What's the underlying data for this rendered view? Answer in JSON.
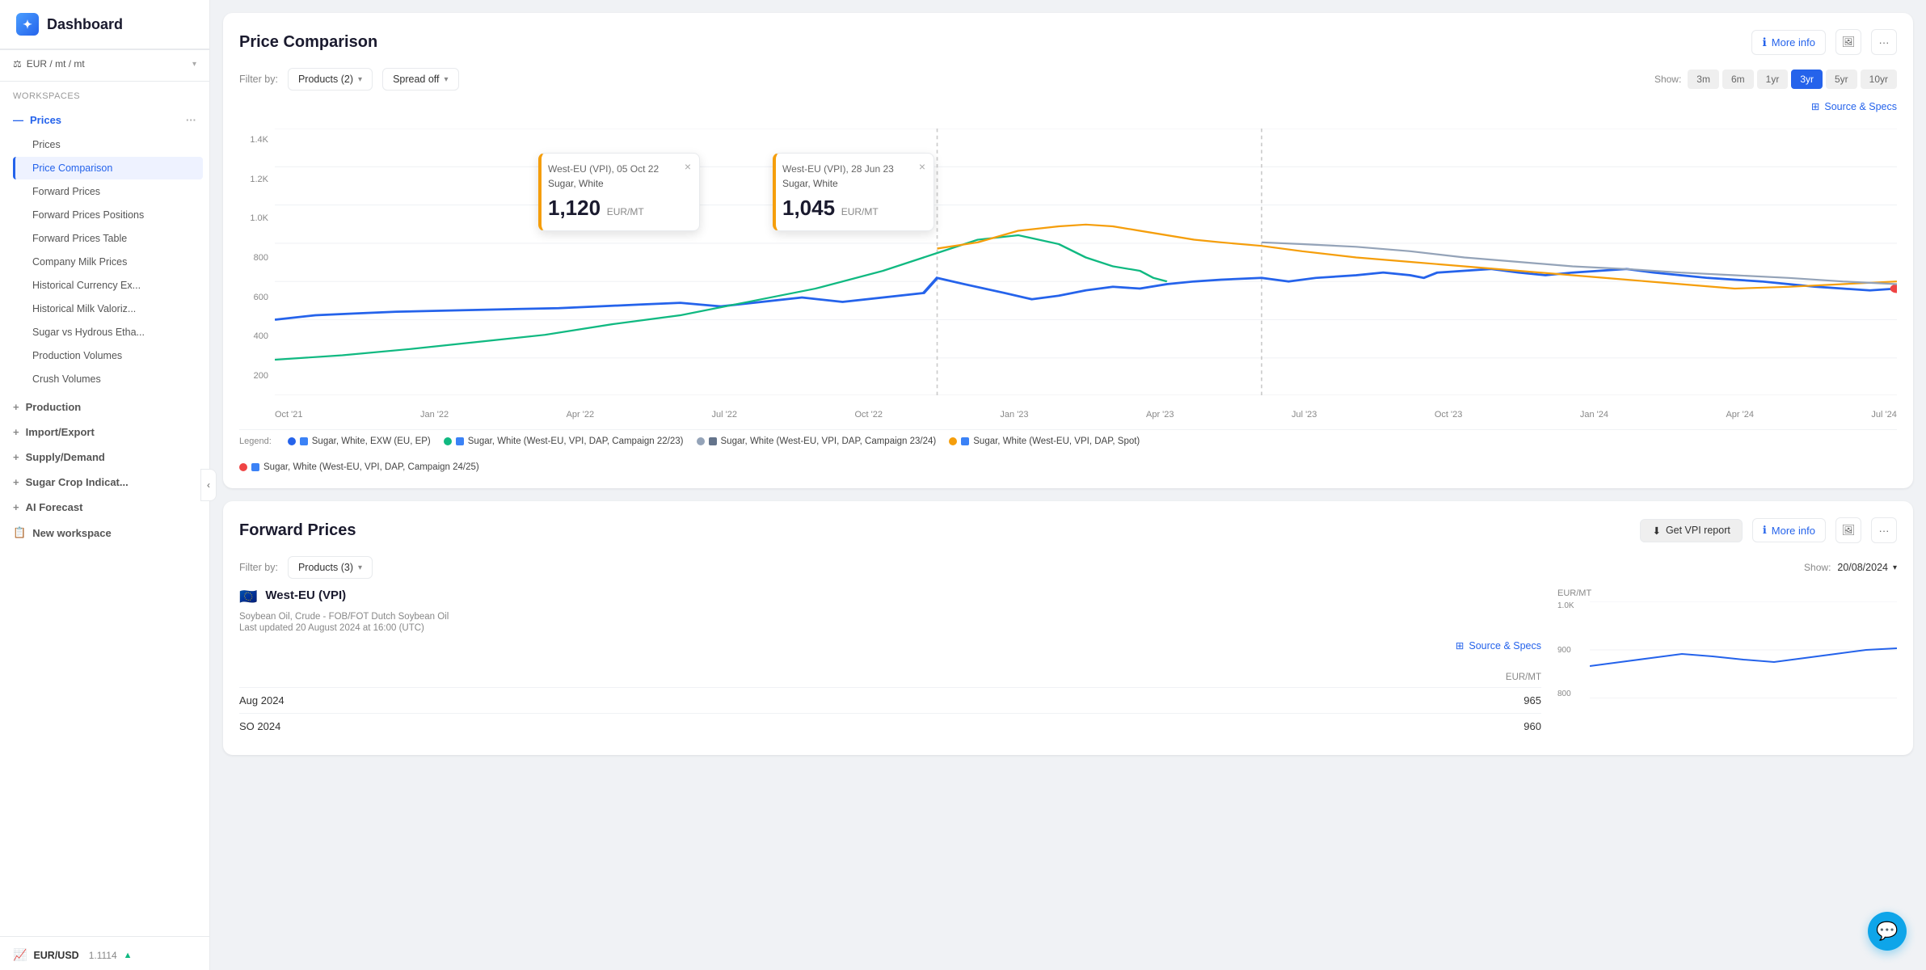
{
  "sidebar": {
    "title": "Dashboard",
    "currency_label": "EUR / mt / mt",
    "workspaces_label": "Workspaces",
    "groups": [
      {
        "id": "prices",
        "label": "Prices",
        "expanded": true,
        "items": [
          {
            "id": "prices-main",
            "label": "Prices",
            "active": false
          },
          {
            "id": "price-comparison",
            "label": "Price Comparison",
            "active": true
          },
          {
            "id": "forward-prices",
            "label": "Forward Prices",
            "active": false
          },
          {
            "id": "forward-prices-positions",
            "label": "Forward Prices Positions",
            "active": false
          },
          {
            "id": "forward-prices-table",
            "label": "Forward Prices Table",
            "active": false
          },
          {
            "id": "company-milk-prices",
            "label": "Company Milk Prices",
            "active": false
          },
          {
            "id": "historical-currency",
            "label": "Historical Currency Ex...",
            "active": false
          },
          {
            "id": "historical-milk",
            "label": "Historical Milk Valoriz...",
            "active": false
          },
          {
            "id": "sugar-vs-hydrous",
            "label": "Sugar vs Hydrous Etha...",
            "active": false
          },
          {
            "id": "production-volumes",
            "label": "Production Volumes",
            "active": false
          },
          {
            "id": "crush-volumes",
            "label": "Crush Volumes",
            "active": false
          }
        ]
      },
      {
        "id": "production",
        "label": "Production",
        "expanded": false
      },
      {
        "id": "import-export",
        "label": "Import/Export",
        "expanded": false
      },
      {
        "id": "supply-demand",
        "label": "Supply/Demand",
        "expanded": false
      },
      {
        "id": "sugar-crop",
        "label": "Sugar Crop Indicat...",
        "expanded": false
      },
      {
        "id": "ai-forecast",
        "label": "AI Forecast",
        "expanded": false
      },
      {
        "id": "new-workspace",
        "label": "New workspace",
        "expanded": false
      }
    ],
    "footer": {
      "currency_pair": "EUR/USD",
      "rate": "1.1114",
      "trend": "up"
    }
  },
  "price_comparison": {
    "title": "Price Comparison",
    "more_info": "More info",
    "filter_label": "Filter by:",
    "filter_value": "Products (2)",
    "spread_label": "Spread off",
    "show_label": "Show:",
    "show_options": [
      "3m",
      "6m",
      "1yr",
      "3yr",
      "5yr",
      "10yr"
    ],
    "active_show": "3yr",
    "source_specs": "Source & Specs",
    "y_labels": [
      "1.4K",
      "1.2K",
      "1.0K",
      "800",
      "600",
      "400",
      "200"
    ],
    "x_labels": [
      "Oct '21",
      "Jan '22",
      "Apr '22",
      "Jul '22",
      "Oct '22",
      "Jan '23",
      "Apr '23",
      "Jul '23",
      "Oct '23",
      "Jan '24",
      "Apr '24",
      "Jul '24"
    ],
    "tooltip1": {
      "location": "West-EU (VPI), 05 Oct 22",
      "product": "Sugar, White",
      "value": "1,120",
      "unit": "EUR/MT"
    },
    "tooltip2": {
      "location": "West-EU (VPI), 28 Jun 23",
      "product": "Sugar, White",
      "value": "1,045",
      "unit": "EUR/MT"
    },
    "legend": [
      {
        "id": "legend-1",
        "color": "#2563eb",
        "shape": "dot",
        "label": "Sugar, White, EXW (EU, EP)"
      },
      {
        "id": "legend-2",
        "color": "#10b981",
        "shape": "dot",
        "flag_color": "#2563eb",
        "label": "Sugar, White (West-EU, VPI, DAP, Campaign 22/23)"
      },
      {
        "id": "legend-3",
        "color": "#94a3b8",
        "shape": "dot",
        "flag_color": "#64748b",
        "label": "Sugar, White (West-EU, VPI, DAP, Campaign 23/24)"
      },
      {
        "id": "legend-4",
        "color": "#f59e0b",
        "shape": "dot",
        "flag_color": "#2563eb",
        "label": "Sugar, White (West-EU, VPI, DAP, Spot)"
      },
      {
        "id": "legend-5",
        "color": "#ef4444",
        "shape": "dot",
        "flag_color": "#2563eb",
        "label": "Sugar, White (West-EU, VPI, DAP, Campaign 24/25)"
      }
    ]
  },
  "forward_prices": {
    "title": "Forward Prices",
    "get_vpi_report": "Get VPI report",
    "more_info": "More info",
    "filter_label": "Filter by:",
    "filter_value": "Products (3)",
    "show_label": "Show:",
    "show_date": "20/08/2024",
    "source_specs": "Source & Specs",
    "product": {
      "region": "West-EU (VPI)",
      "name": "Soybean Oil, Crude - FOB/FOT Dutch Soybean Oil",
      "last_updated": "Last updated 20 August 2024 at 16:00 (UTC)",
      "unit": "EUR/MT",
      "rows": [
        {
          "period": "Aug 2024",
          "value": "965"
        },
        {
          "period": "SO 2024",
          "value": "960"
        }
      ]
    },
    "chart_y_labels": [
      "1.0K",
      "900",
      "800"
    ],
    "chart_label": "EUR/MT"
  }
}
